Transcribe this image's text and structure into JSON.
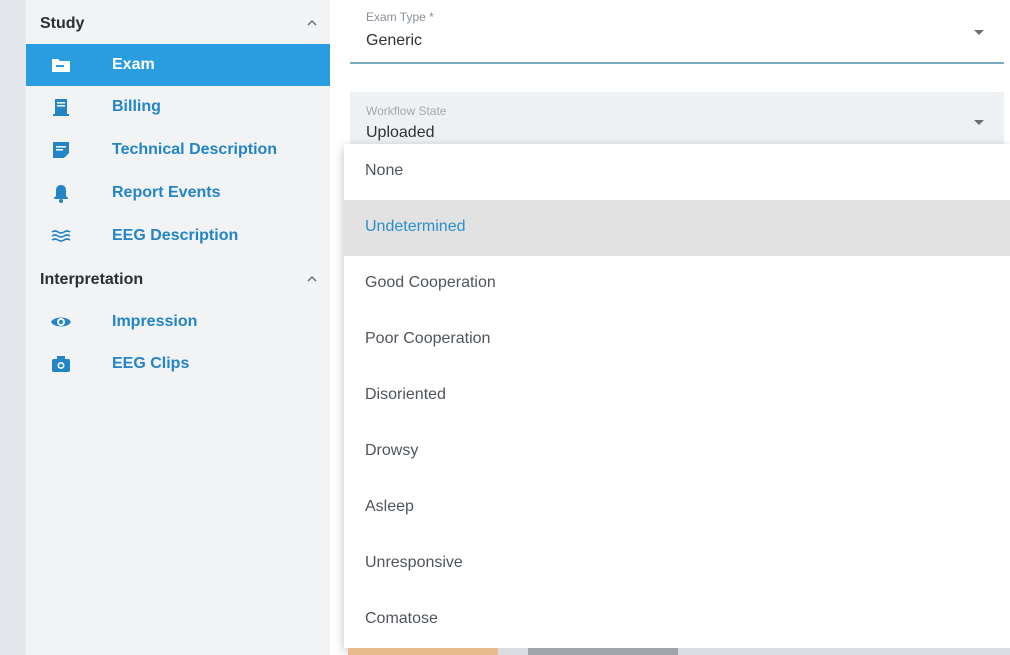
{
  "sidebar": {
    "sections": [
      {
        "title": "Study",
        "items": [
          {
            "label": "Exam",
            "icon": "folder-icon"
          },
          {
            "label": "Billing",
            "icon": "receipt-icon"
          },
          {
            "label": "Technical Description",
            "icon": "note-icon"
          },
          {
            "label": "Report Events",
            "icon": "bell-icon"
          },
          {
            "label": "EEG Description",
            "icon": "waves-icon"
          }
        ]
      },
      {
        "title": "Interpretation",
        "items": [
          {
            "label": "Impression",
            "icon": "eye-icon"
          },
          {
            "label": "EEG Clips",
            "icon": "camera-icon"
          }
        ]
      }
    ],
    "active_item": "Exam"
  },
  "form": {
    "exam_type": {
      "label": "Exam Type *",
      "value": "Generic"
    },
    "workflow_state": {
      "label": "Workflow State",
      "value": "Uploaded"
    }
  },
  "dropdown": {
    "options": [
      "None",
      "Undetermined",
      "Good Cooperation",
      "Poor Cooperation",
      "Disoriented",
      "Drowsy",
      "Asleep",
      "Unresponsive",
      "Comatose"
    ],
    "highlighted": "Undetermined"
  },
  "colors": {
    "accent": "#2a9de0",
    "link": "#2384c6",
    "highlight_bg": "#e2e2e2"
  }
}
